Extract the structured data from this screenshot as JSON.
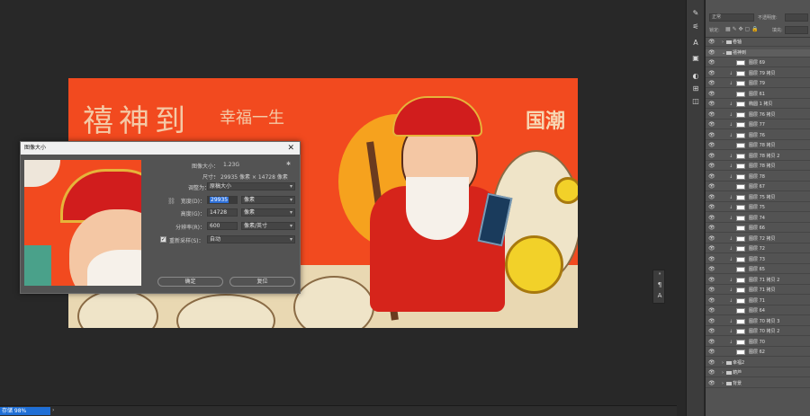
{
  "canvas": {
    "calligraphy_main": "禧神到",
    "calligraphy_slogan": "幸福一生",
    "calligraphy_right": "国潮"
  },
  "dialog": {
    "title": "图像大小",
    "close_glyph": "✕",
    "image_size_label": "图像大小：",
    "image_size_value": "1.23G",
    "dimensions_label": "尺寸：",
    "dimensions_value": "29935 像素 × 14728 像素",
    "fit_label": "调整为：",
    "fit_value": "原稿大小",
    "width_label": "宽度(D)：",
    "width_value": "29935",
    "width_unit": "像素",
    "height_label": "高度(G)：",
    "height_value": "14728",
    "height_unit": "像素",
    "resolution_label": "分辨率(R)：",
    "resolution_value": "600",
    "resolution_unit": "像素/英寸",
    "resample_label": "重新采样(S)：",
    "resample_value": "自动",
    "resample_checked": true,
    "ok_label": "确定",
    "reset_label": "复位"
  },
  "statusbar": {
    "zoom": "存储 98%"
  },
  "layers_panel": {
    "mode": "正常",
    "opacity_label": "不透明度:",
    "lock_label": "锁定:",
    "fill_label": "填充:",
    "layers": [
      {
        "name": "卷轴",
        "type": "group",
        "collapsed": true
      },
      {
        "name": "禧神到",
        "type": "group",
        "collapsed": false
      },
      {
        "name": "图层 69",
        "type": "layer"
      },
      {
        "name": "图层 79 拷贝",
        "type": "layer",
        "clipped": true
      },
      {
        "name": "图层 79",
        "type": "layer",
        "clipped": true
      },
      {
        "name": "图层 61",
        "type": "layer"
      },
      {
        "name": "椭圆 1 拷贝",
        "type": "layer",
        "clipped": true
      },
      {
        "name": "图层 76 拷贝",
        "type": "layer",
        "clipped": true
      },
      {
        "name": "图层 77",
        "type": "layer",
        "clipped": true
      },
      {
        "name": "图层 76",
        "type": "layer",
        "clipped": true
      },
      {
        "name": "图层 78 拷贝",
        "type": "layer"
      },
      {
        "name": "图层 78 拷贝 2",
        "type": "layer",
        "clipped": true
      },
      {
        "name": "图层 78 拷贝",
        "type": "layer",
        "clipped": true
      },
      {
        "name": "图层 78",
        "type": "layer",
        "clipped": true
      },
      {
        "name": "图层 67",
        "type": "layer"
      },
      {
        "name": "图层 75 拷贝",
        "type": "layer",
        "clipped": true
      },
      {
        "name": "图层 75",
        "type": "layer",
        "clipped": true
      },
      {
        "name": "图层 74",
        "type": "layer",
        "clipped": true
      },
      {
        "name": "图层 66",
        "type": "layer"
      },
      {
        "name": "图层 72 拷贝",
        "type": "layer",
        "clipped": true
      },
      {
        "name": "图层 72",
        "type": "layer",
        "clipped": true
      },
      {
        "name": "图层 73",
        "type": "layer",
        "clipped": true
      },
      {
        "name": "图层 65",
        "type": "layer"
      },
      {
        "name": "图层 71 拷贝 2",
        "type": "layer",
        "clipped": true
      },
      {
        "name": "图层 71 拷贝",
        "type": "layer",
        "clipped": true
      },
      {
        "name": "图层 71",
        "type": "layer",
        "clipped": true
      },
      {
        "name": "图层 64",
        "type": "layer"
      },
      {
        "name": "图层 70 拷贝 3",
        "type": "layer",
        "clipped": true
      },
      {
        "name": "图层 70 拷贝 2",
        "type": "layer",
        "clipped": true
      },
      {
        "name": "图层 70",
        "type": "layer",
        "clipped": true
      },
      {
        "name": "图层 62",
        "type": "layer"
      },
      {
        "name": "幸福2",
        "type": "group",
        "collapsed": true
      },
      {
        "name": "葫芦",
        "type": "group",
        "collapsed": true
      },
      {
        "name": "背景",
        "type": "group",
        "collapsed": true
      }
    ]
  },
  "icons": {
    "brush": "brush-icon",
    "adjust": "adjust-icon",
    "text": "text-icon",
    "paragraph": "paragraph-icon"
  }
}
